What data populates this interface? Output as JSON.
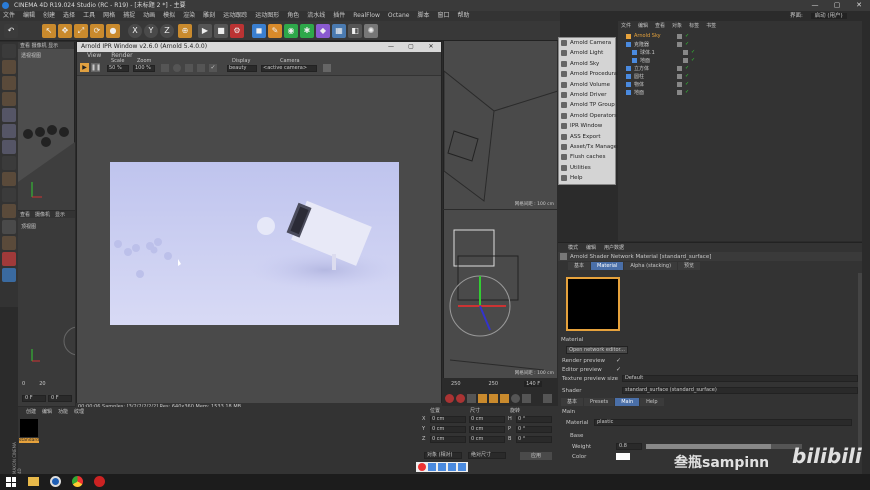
{
  "window": {
    "title": "CINEMA 4D R19.024 Studio (RC - R19) - [未标题 2 *] - 主要"
  },
  "menubar": [
    "文件",
    "编辑",
    "创建",
    "选择",
    "工具",
    "网格",
    "捕捉",
    "动画",
    "模拟",
    "渲染",
    "雕刻",
    "运动跟踪",
    "运动图形",
    "角色",
    "流水线",
    "插件",
    "RealFlow",
    "Octane",
    "脚本",
    "窗口",
    "帮助"
  ],
  "layout_label": "界面:",
  "layout_value": "启动 (用户)",
  "arnold": {
    "title": "Arnold IPR Window v2.6.0 (Arnold 5.4.0.0)",
    "menu": [
      "View",
      "Render"
    ],
    "scale_label": "Scale",
    "zoom_label": "Zoom",
    "display_label": "Display",
    "camera_label": "Camera",
    "scale_value": "50 %",
    "zoom_value": "100 %",
    "display_value": "beauty",
    "camera_value": "<active camera>",
    "status": "00:00:06  Samples: [3/2/2/2/2/2]  Res: 640x360  Mem: 1533.18 MB"
  },
  "viewport": {
    "left_label": "透视视图",
    "grid_top": "网格间距 : 100 cm",
    "grid_bot": "网格间距 : 100 cm"
  },
  "arnold_menu": [
    "Arnold Camera",
    "Arnold Light",
    "Arnold Sky",
    "Arnold Procedural",
    "Arnold Volume",
    "Arnold Driver",
    "Arnold TP Group",
    "Arnold Operators",
    "IPR Window",
    "ASS Export",
    "Asset/Tx Manager",
    "Flush caches",
    "Utilities",
    "Help"
  ],
  "objmgr": {
    "tabs": [
      "文件",
      "编辑",
      "查看",
      "对象",
      "标签",
      "书签"
    ],
    "objects": [
      "Arnold Sky",
      "克隆器",
      "球体.1",
      "地面",
      "立方体",
      "圆柱",
      "物体",
      "地面"
    ]
  },
  "attr": {
    "tabs_top": [
      "模式",
      "编辑",
      "用户数据"
    ],
    "material_title": "Arnold Shader Network Material [standard_surface]",
    "tabs": [
      "基本",
      "Material",
      "Alpha (stacking)",
      "预览"
    ],
    "section_material": "Material",
    "open_editor": "Open network editor...",
    "render_preview": "Render preview",
    "editor_preview": "Editor preview",
    "texture_preview_size": "Texture preview size",
    "texture_preview_value": "Default",
    "shader_label": "Shader",
    "shader_value": "standard_surface (standard_surface)",
    "tabs2": [
      "基本",
      "Presets",
      "Main",
      "Help"
    ],
    "main_label": "Main",
    "material_sub": "Material",
    "material_sub_value": "plastic",
    "base_label": "Base",
    "weight_label": "Weight",
    "weight_value": "0.8",
    "color_label": "Color"
  },
  "coord": {
    "headers": [
      "位置",
      "尺寸",
      "旋转"
    ],
    "rows": [
      {
        "axis": "X",
        "pos": "0 cm",
        "size": "0 cm",
        "rot_axis": "H",
        "rot": "0 °"
      },
      {
        "axis": "Y",
        "pos": "0 cm",
        "size": "0 cm",
        "rot_axis": "P",
        "rot": "0 °"
      },
      {
        "axis": "Z",
        "pos": "0 cm",
        "size": "0 cm",
        "rot_axis": "B",
        "rot": "0 °"
      }
    ],
    "mode": "对象 (相对)",
    "mode2": "绝对尺寸",
    "apply": "应用"
  },
  "materials": {
    "tabs": [
      "创建",
      "编辑",
      "功能",
      "纹理"
    ],
    "swatch_label": "standard"
  },
  "timeline": {
    "start": "0",
    "mid": "20",
    "frame": "0 F",
    "field": "0 F"
  },
  "mid_bottom": {
    "frame_a": "250",
    "frame_b": "250",
    "frame_c": "140 F"
  },
  "left_bottom": {
    "tabs": [
      "查看",
      "摄像机",
      "显示"
    ],
    "label": "顶视图"
  },
  "maxon": "MAXON CINEMA 4D",
  "watermark": {
    "text": "叁瓶sampinn",
    "logo": "bilibili"
  },
  "colors": {
    "accent": "#4a6fa8",
    "render_bg": "#c8ccf0",
    "swatch_border": "#e6a23c"
  }
}
